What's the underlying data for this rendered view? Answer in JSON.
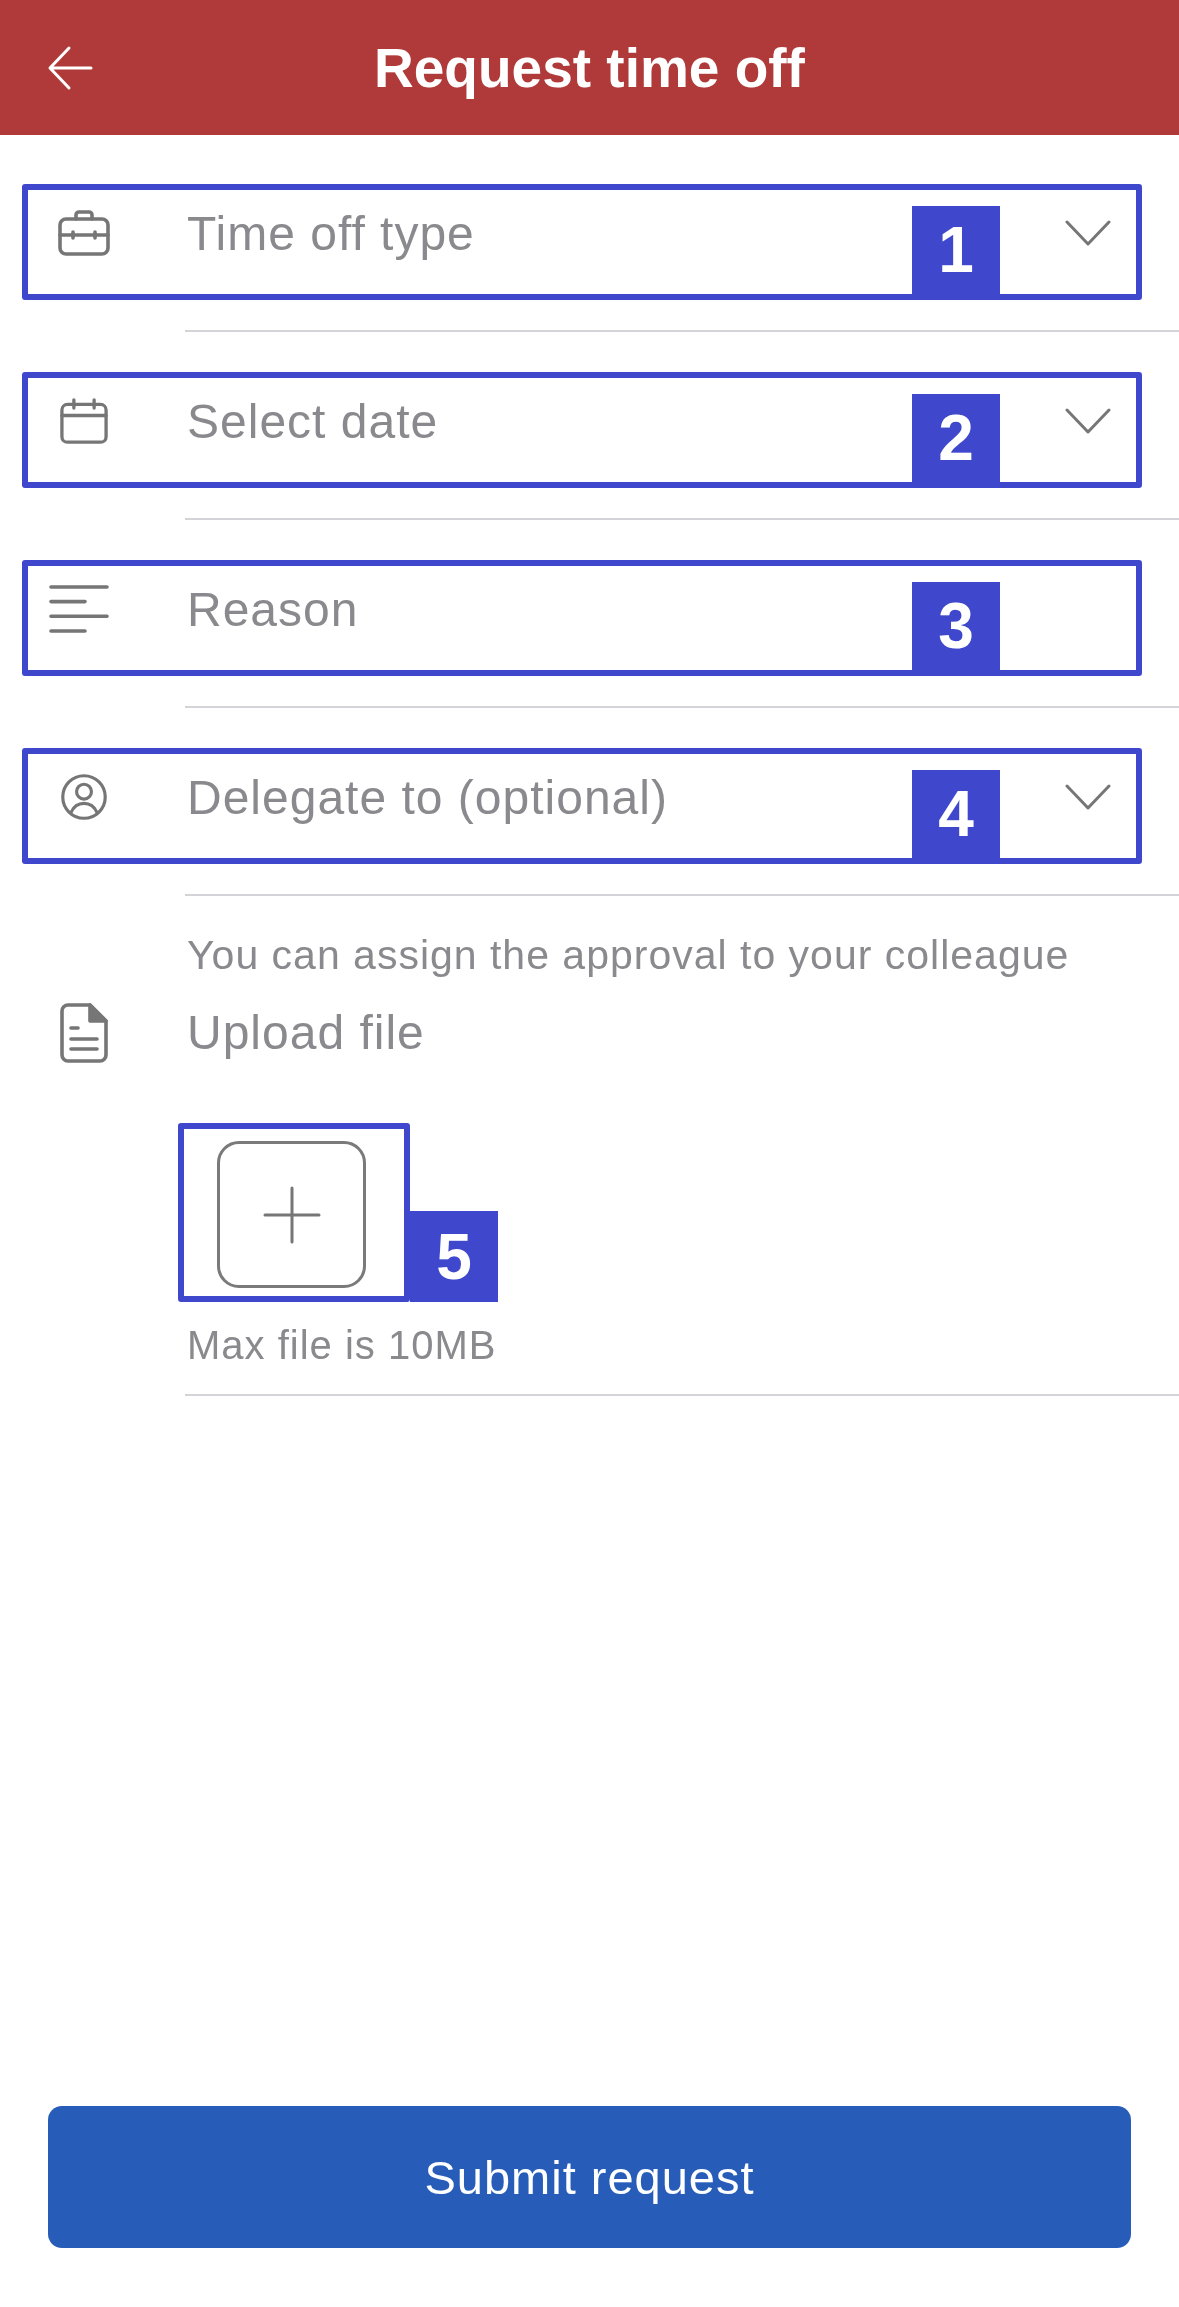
{
  "header": {
    "title": "Request time off"
  },
  "fields": [
    {
      "kind": "category",
      "placeholder": "Time off type",
      "dropdown": true,
      "callout": "1"
    },
    {
      "kind": "date",
      "placeholder": "Select date",
      "dropdown": true,
      "callout": "2"
    },
    {
      "kind": "text",
      "placeholder": "Reason",
      "dropdown": false,
      "callout": "3"
    },
    {
      "kind": "person",
      "placeholder": "Delegate to (optional)",
      "dropdown": true,
      "callout": "4",
      "hint": "You can assign the approval to your colleague"
    }
  ],
  "upload": {
    "label": "Upload file",
    "callout": "5",
    "note": "Max file is 10MB"
  },
  "submit_button": {
    "label": "Submit request"
  }
}
